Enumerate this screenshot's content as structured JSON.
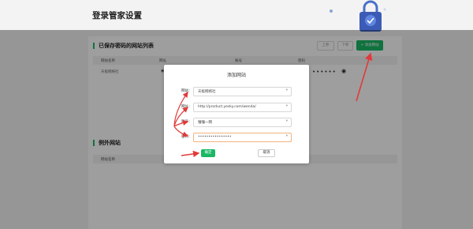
{
  "page": {
    "title": "登录管家设置"
  },
  "saved_section": {
    "title": "已保存密码的网站列表",
    "btn_up": "上移",
    "btn_down": "下移",
    "btn_add": "+ 添加网站",
    "columns": [
      "网站名称",
      "网址",
      "账号",
      "密码"
    ],
    "row": {
      "name": "天极网络社",
      "password_mask": "••••••"
    }
  },
  "except_section": {
    "title": "例外网站",
    "columns": [
      "网站名称"
    ]
  },
  "dialog": {
    "title": "添加网站",
    "fields": [
      {
        "label": "网站：",
        "value": "天极网络社"
      },
      {
        "label": "网址：",
        "value": "http://product.yesky.com/wenda/"
      },
      {
        "label": "账号：",
        "value": "懂懂一网"
      },
      {
        "label": "密码：",
        "value": "••••••••••••••••"
      }
    ],
    "ok": "确定",
    "cancel": "取消"
  },
  "colors": {
    "accent": "#1ab865",
    "arrow": "#e23a3a",
    "focus_border": "#f0b37e"
  }
}
